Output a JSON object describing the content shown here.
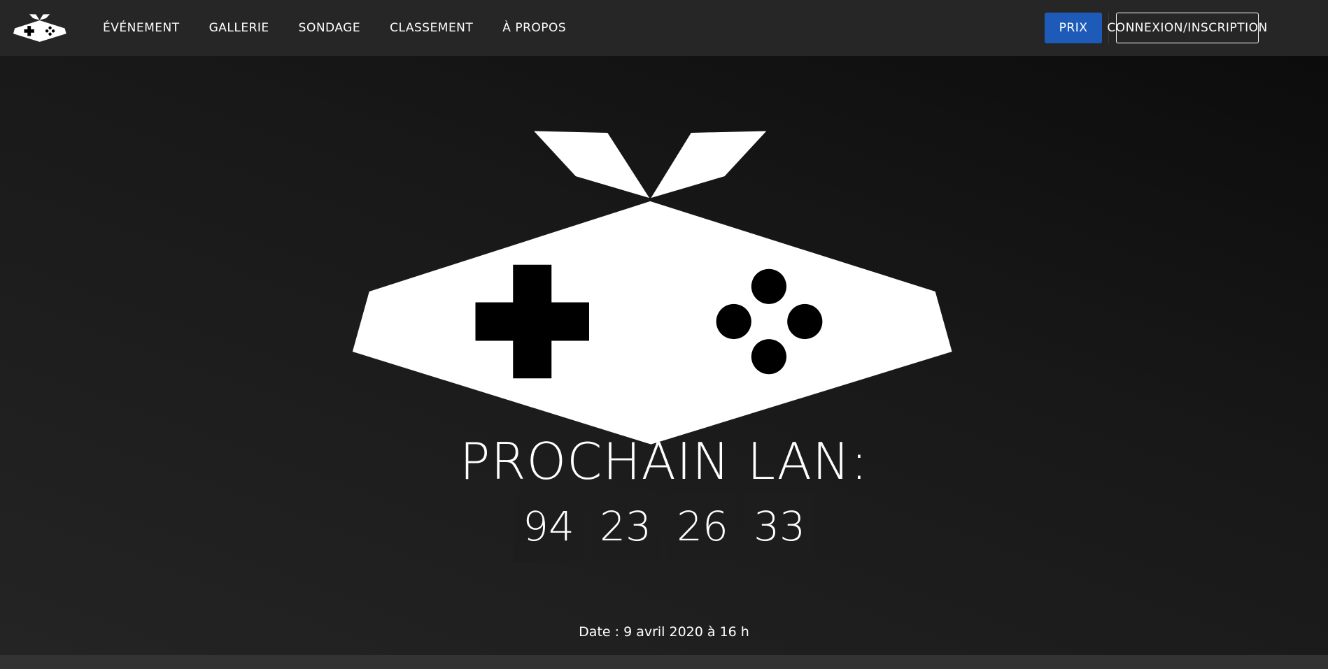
{
  "navbar": {
    "logo_icon": "gamepad-bow-icon",
    "links": [
      {
        "label": "ÉVÉNEMENT"
      },
      {
        "label": "GALLERIE"
      },
      {
        "label": "SONDAGE"
      },
      {
        "label": "CLASSEMENT"
      },
      {
        "label": "À PROPOS"
      }
    ],
    "prize_button": "PRIX",
    "login_button": "CONNEXION/INSCRIPTION"
  },
  "hero": {
    "logo_icon": "gamepad-bow-icon",
    "title": "PROCHAIN LAN:",
    "countdown": [
      "94",
      "23",
      "26",
      "33"
    ],
    "date": "Date : 9 avril 2020 à 16 h"
  },
  "colors": {
    "accent": "#1e5bb8",
    "navbar_bg": "#262626",
    "hero_bg_dark": "#0c0c0c",
    "hero_bg_light": "#242424"
  }
}
